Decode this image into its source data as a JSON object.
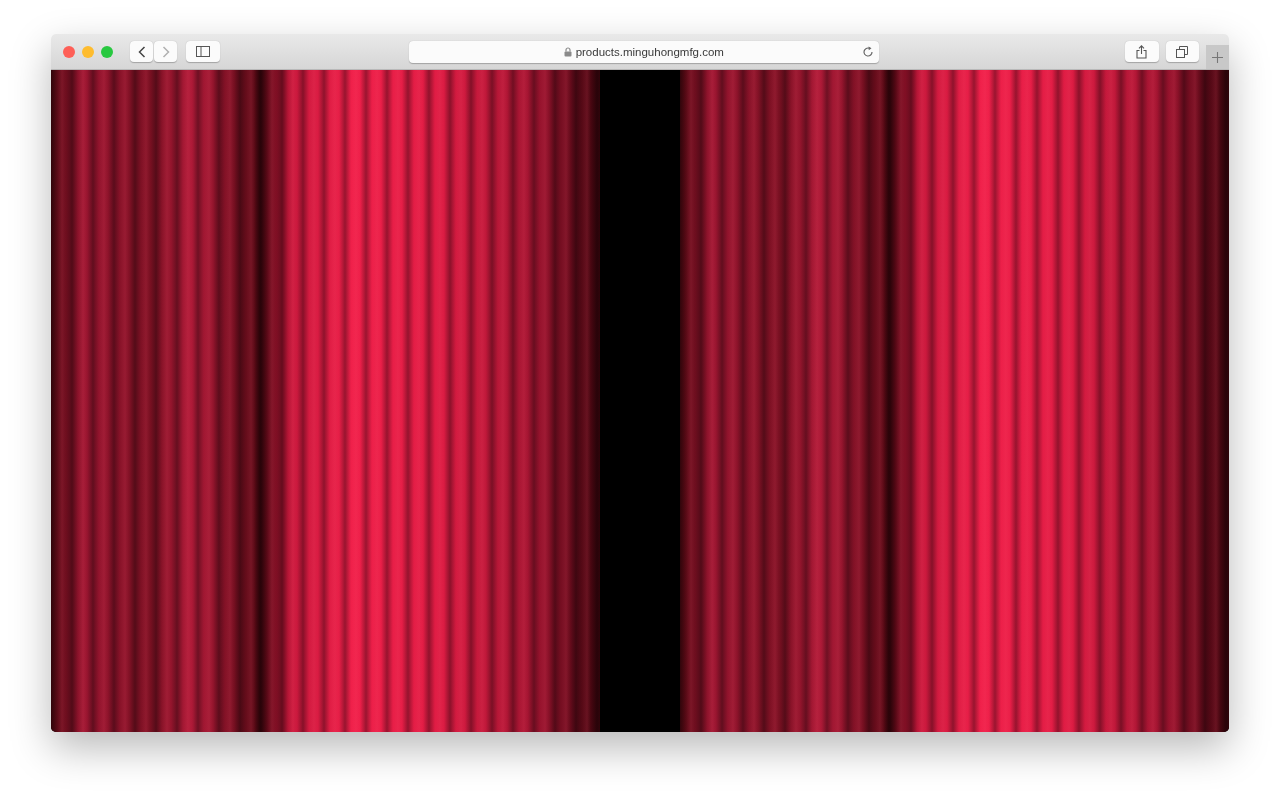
{
  "window": {
    "url": "products.minguhongmfg.com",
    "secure": true
  },
  "nav_buttons": [
    {
      "kind": "back",
      "disabled": false
    },
    {
      "kind": "forward",
      "disabled": true
    }
  ]
}
